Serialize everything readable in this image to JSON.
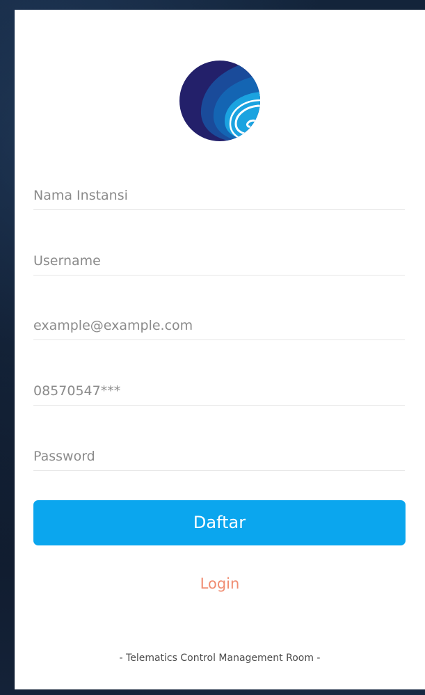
{
  "form": {
    "fields": [
      {
        "name": "nama-instansi",
        "placeholder": "Nama Instansi",
        "value": "",
        "type": "text"
      },
      {
        "name": "username",
        "placeholder": "Username",
        "value": "",
        "type": "text"
      },
      {
        "name": "email",
        "placeholder": "example@example.com",
        "value": "",
        "type": "text"
      },
      {
        "name": "phone",
        "placeholder": "08570547***",
        "value": "",
        "type": "text"
      },
      {
        "name": "password",
        "placeholder": "Password",
        "value": "",
        "type": "password"
      }
    ],
    "submit_label": "Daftar",
    "login_link": "Login"
  },
  "footer": {
    "text": "- Telematics Control Management Room -"
  },
  "colors": {
    "button": "#0ba6ee",
    "login_link": "#f08d72",
    "logo_dark": "#23206a",
    "logo_mid": "#1465b3",
    "logo_light": "#1ba3e0"
  },
  "logo": {
    "icon": "globe-wave-logo"
  }
}
